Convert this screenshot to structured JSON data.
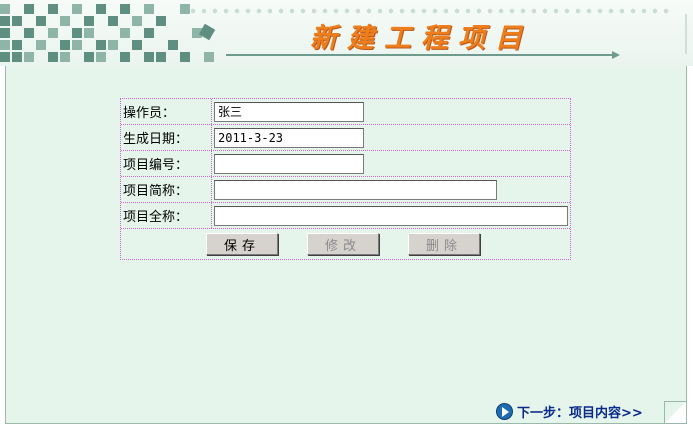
{
  "header": {
    "title": "新建工程项目"
  },
  "form": {
    "operator": {
      "label": "操作员：",
      "value": "张三"
    },
    "create_date": {
      "label": "生成日期：",
      "value": "2011-3-23"
    },
    "project_code": {
      "label": "项目编号：",
      "value": ""
    },
    "project_short_name": {
      "label": "项目简称：",
      "value": ""
    },
    "project_full_name": {
      "label": "项目全称：",
      "value": ""
    }
  },
  "buttons": {
    "save": "保存",
    "edit": "修改",
    "delete": "删除"
  },
  "footer": {
    "next_label": "下一步：项目内容>>"
  },
  "colors": {
    "panel_bg": "#e6f5ec",
    "title": "#ee7d1b",
    "form_border": "#cc66cc",
    "link": "#0a2a8a"
  },
  "icons": {
    "next": "arrow-circle-right-icon"
  }
}
